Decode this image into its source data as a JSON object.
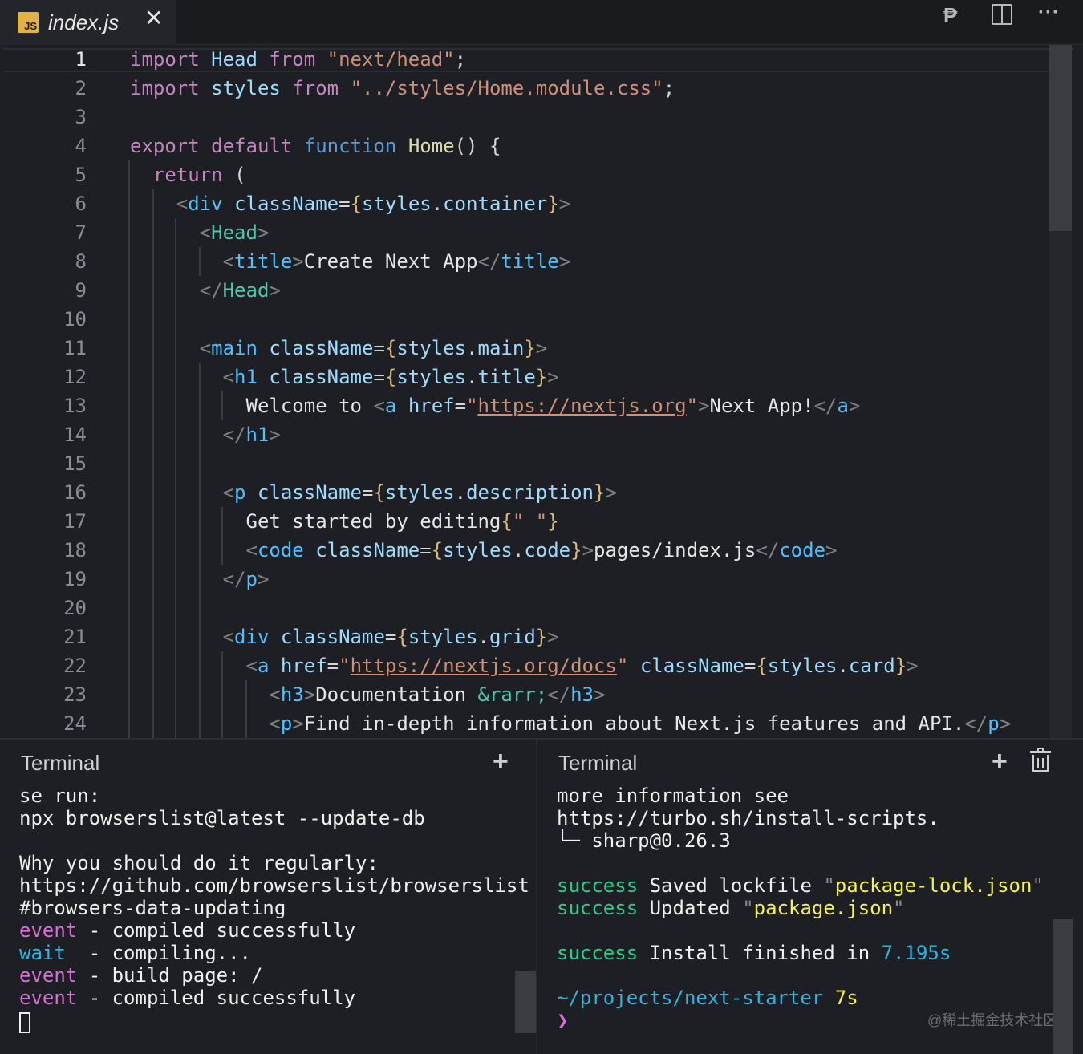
{
  "tab": {
    "badge": "JS",
    "title": "index.js",
    "close": "✕"
  },
  "toolbar": {
    "preview_icon": "₱",
    "more_icon": "···"
  },
  "editor": {
    "line_numbers": [
      "1",
      "2",
      "3",
      "4",
      "5",
      "6",
      "7",
      "8",
      "9",
      "10",
      "11",
      "12",
      "13",
      "14",
      "15",
      "16",
      "17",
      "18",
      "19",
      "20",
      "21",
      "22",
      "23",
      "24"
    ]
  },
  "terminal_left": {
    "title": "Terminal",
    "add_icon": "+",
    "lines": [
      [
        {
          "t": "se run:",
          "c": ""
        }
      ],
      [
        {
          "t": "npx browserslist@latest --update-db",
          "c": ""
        }
      ],
      [],
      [
        {
          "t": "Why you should do it regularly:",
          "c": ""
        }
      ],
      [
        {
          "t": "https://github.com/browserslist/browserslist",
          "c": ""
        }
      ],
      [
        {
          "t": "#browsers-data-updating",
          "c": ""
        }
      ],
      [
        {
          "t": "event",
          "c": "mag"
        },
        {
          "t": " - compiled successfully",
          "c": ""
        }
      ],
      [
        {
          "t": "wait",
          "c": "cy"
        },
        {
          "t": "  - compiling...",
          "c": ""
        }
      ],
      [
        {
          "t": "event",
          "c": "mag"
        },
        {
          "t": " - build page: /",
          "c": ""
        }
      ],
      [
        {
          "t": "event",
          "c": "mag"
        },
        {
          "t": " - compiled successfully",
          "c": ""
        }
      ]
    ]
  },
  "terminal_right": {
    "title": "Terminal",
    "add_icon": "+",
    "lines": [
      [
        {
          "t": "more information see",
          "c": ""
        }
      ],
      [
        {
          "t": "https://turbo.sh/install-scripts.",
          "c": ""
        }
      ],
      [
        {
          "t": "└─ sharp@0.26.3",
          "c": ""
        }
      ],
      [],
      [
        {
          "t": "success",
          "c": "grn"
        },
        {
          "t": " Saved lockfile ",
          "c": ""
        },
        {
          "t": "\"",
          "c": "dimq"
        },
        {
          "t": "package-lock.json",
          "c": "yel"
        },
        {
          "t": "\"",
          "c": "dimq"
        }
      ],
      [
        {
          "t": "success",
          "c": "grn"
        },
        {
          "t": " Updated ",
          "c": ""
        },
        {
          "t": "\"",
          "c": "dimq"
        },
        {
          "t": "package.json",
          "c": "yel"
        },
        {
          "t": "\"",
          "c": "dimq"
        }
      ],
      [],
      [
        {
          "t": "success",
          "c": "grn"
        },
        {
          "t": " Install finished in ",
          "c": ""
        },
        {
          "t": "7.195s",
          "c": "cy"
        }
      ],
      [],
      [
        {
          "t": "~/projects/next-starter",
          "c": "cy"
        },
        {
          "t": " 7s",
          "c": "yel"
        }
      ],
      [
        {
          "t": "❯",
          "c": "arrow"
        }
      ]
    ],
    "watermark": "@稀土掘金技术社区"
  }
}
